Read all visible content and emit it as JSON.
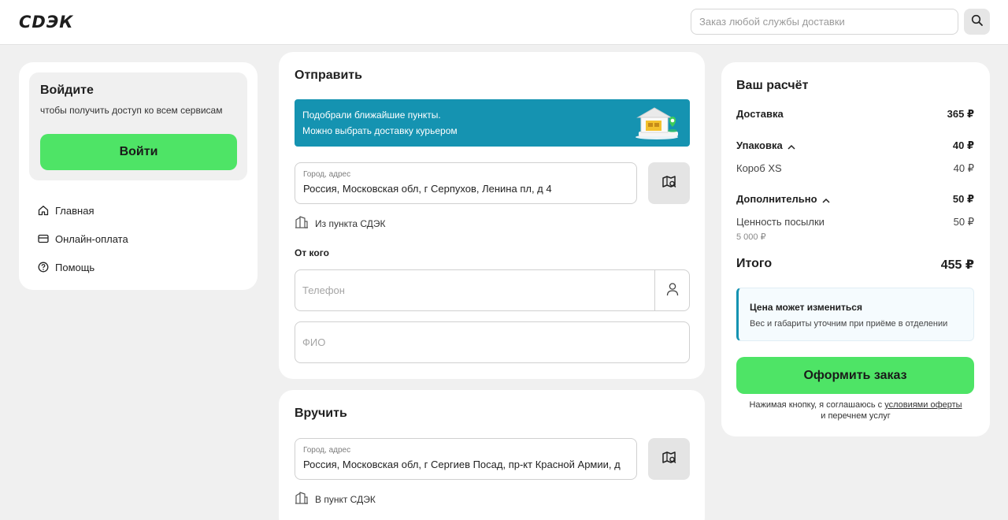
{
  "header": {
    "logo": "СDЭК",
    "search_placeholder": "Заказ любой службы доставки"
  },
  "sidebar": {
    "login_title": "Войдите",
    "login_subtitle": "чтобы получить доступ ко всем сервисам",
    "login_button": "Войти",
    "nav": [
      {
        "label": "Главная",
        "icon": "home-icon"
      },
      {
        "label": "Онлайн-оплата",
        "icon": "card-icon"
      },
      {
        "label": "Помощь",
        "icon": "help-icon"
      }
    ]
  },
  "send": {
    "title": "Отправить",
    "banner_line1": "Подобрали ближайшие пункты.",
    "banner_line2": "Можно выбрать доставку курьером",
    "address_label": "Город, адрес",
    "address_value": "Россия, Московская обл, г Серпухов, Ленина пл, д 4",
    "point_label": "Из пункта СДЭК",
    "from_label": "От кого",
    "phone_placeholder": "Телефон",
    "name_placeholder": "ФИО"
  },
  "deliver": {
    "title": "Вручить",
    "address_label": "Город, адрес",
    "address_value": "Россия, Московская обл, г Сергиев Посад, пр-кт Красной Армии, д",
    "point_label": "В пункт СДЭК"
  },
  "calc": {
    "title": "Ваш расчёт",
    "delivery_label": "Доставка",
    "delivery_value": "365 ₽",
    "packaging_label": "Упаковка",
    "packaging_value": "40 ₽",
    "box_label": "Короб XS",
    "box_value": "40 ₽",
    "extra_label": "Дополнительно",
    "extra_value": "50 ₽",
    "insurance_label": "Ценность посылки",
    "insurance_value": "50 ₽",
    "insurance_amount": "5 000 ₽",
    "total_label": "Итого",
    "total_value": "455 ₽",
    "notice_title": "Цена может измениться",
    "notice_text": "Вес и габариты уточним при приёме в отделении",
    "order_button": "Оформить заказ",
    "terms_prefix": "Нажимая кнопку, я соглашаюсь с ",
    "terms_link": "условиями оферты",
    "terms_suffix": "и перечнем услуг"
  },
  "colors": {
    "accent_green": "#4ee466",
    "banner_blue": "#1593b1",
    "background": "#f0f0f0"
  }
}
